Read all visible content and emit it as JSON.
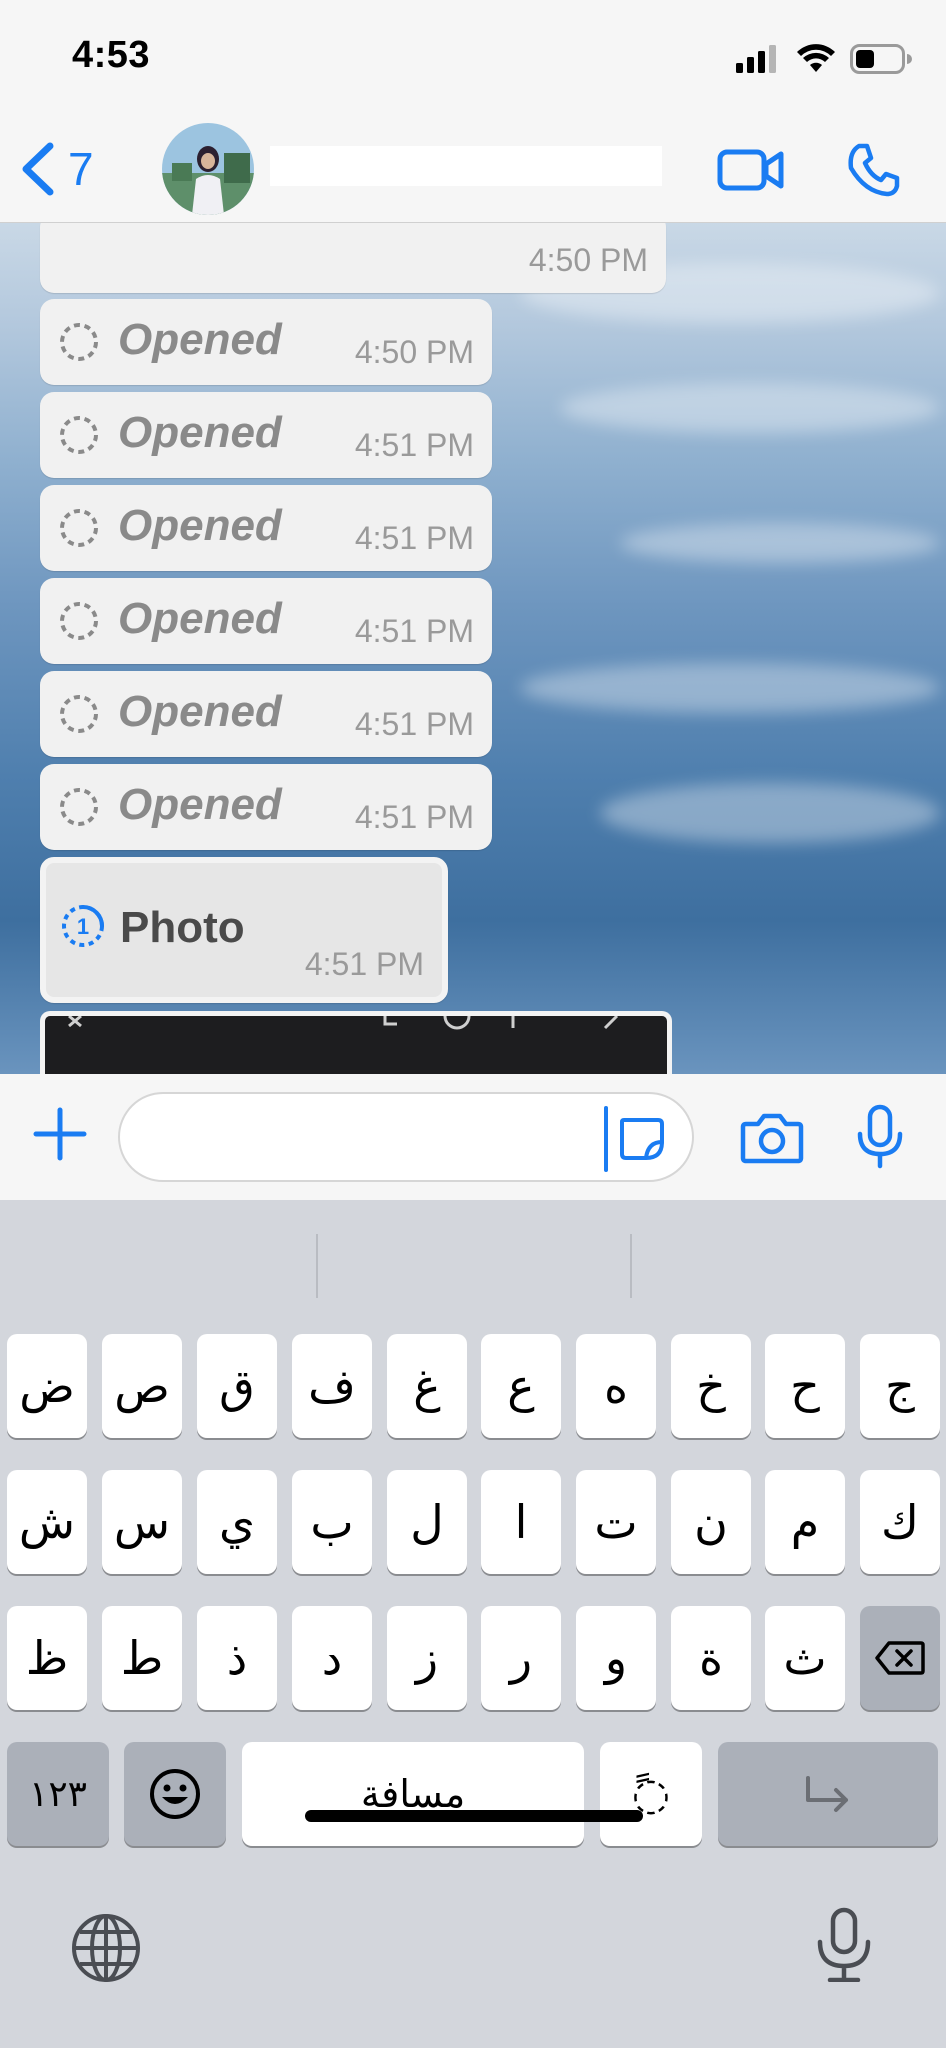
{
  "status_bar": {
    "time": "4:53"
  },
  "nav": {
    "back_count": "7"
  },
  "messages": [
    {
      "type": "text",
      "time": "4:50 PM"
    },
    {
      "type": "opened",
      "label": "Opened",
      "time": "4:50 PM"
    },
    {
      "type": "opened",
      "label": "Opened",
      "time": "4:51 PM"
    },
    {
      "type": "opened",
      "label": "Opened",
      "time": "4:51 PM"
    },
    {
      "type": "opened",
      "label": "Opened",
      "time": "4:51 PM"
    },
    {
      "type": "opened",
      "label": "Opened",
      "time": "4:51 PM"
    },
    {
      "type": "opened",
      "label": "Opened",
      "time": "4:51 PM"
    },
    {
      "type": "view-once-photo",
      "label": "Photo",
      "time": "4:51 PM"
    }
  ],
  "keyboard": {
    "row1": [
      "ض",
      "ص",
      "ق",
      "ف",
      "غ",
      "ع",
      "ه",
      "خ",
      "ح",
      "ج"
    ],
    "row2": [
      "ش",
      "س",
      "ي",
      "ب",
      "ل",
      "ا",
      "ت",
      "ن",
      "م",
      "ك"
    ],
    "row3": [
      "ظ",
      "ط",
      "ذ",
      "د",
      "ز",
      "ر",
      "و",
      "ة",
      "ث"
    ],
    "numbers_label": "١٢٣",
    "space_label": "مسافة",
    "diacritic_label": "ً◌"
  },
  "colors": {
    "accent": "#1a7cf2",
    "bubble": "#f1f1f1",
    "keyboard_bg": "#d3d6dc"
  }
}
